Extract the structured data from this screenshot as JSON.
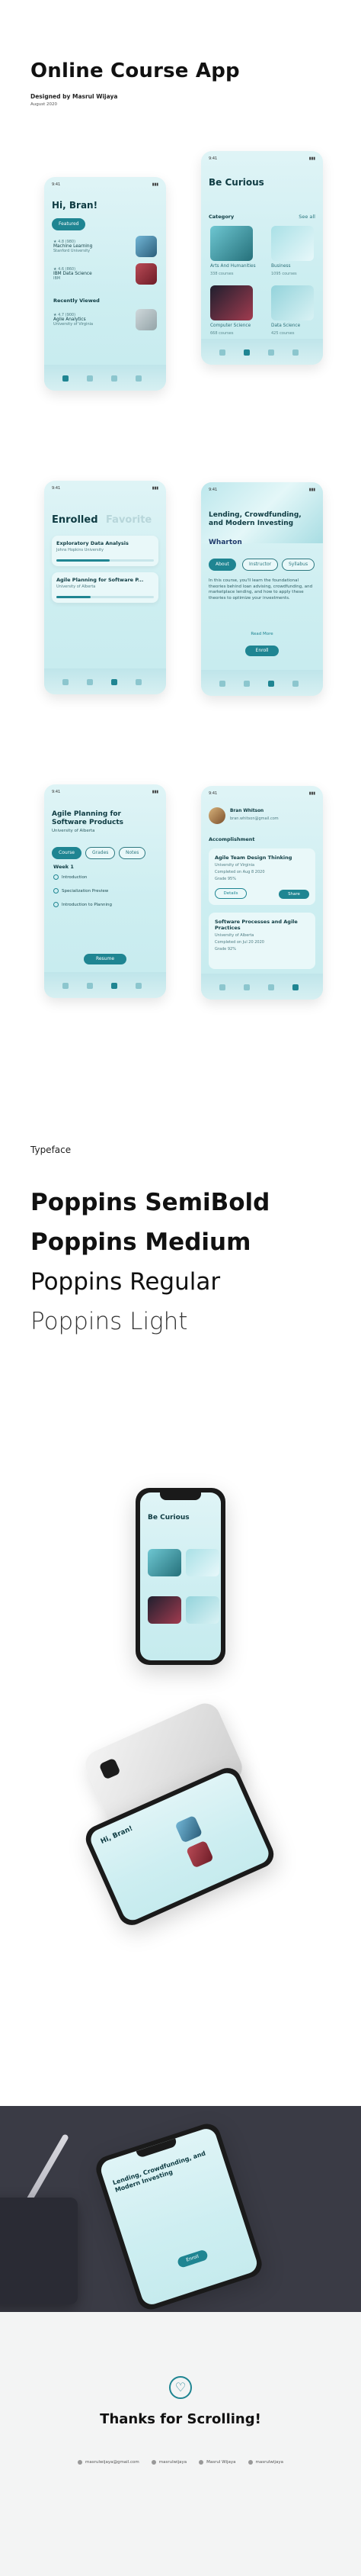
{
  "header": {
    "title": "Online Course App",
    "designed_by": "Designed by Masrul Wijaya",
    "date": "August 2020"
  },
  "screens": {
    "home": {
      "status_left": "9:41",
      "status_right": "▮▮▮",
      "greeting": "Hi, Bran!",
      "featured_chip": "Featured",
      "featured_items": [
        {
          "badge": "★ 4.8 (980)",
          "title": "Machine Learning",
          "sub": "Stanford University"
        },
        {
          "badge": "★ 4.6 (860)",
          "title": "IBM Data Science",
          "sub": "IBM"
        }
      ],
      "recent_label": "Recently Viewed",
      "recent_item": {
        "badge": "★ 4.7 (900)",
        "title": "Agile Analytics",
        "sub": "University of Virginia"
      }
    },
    "browse": {
      "status_left": "9:41",
      "status_right": "▮▮▮",
      "title": "Be Curious",
      "category_label": "Category",
      "category_right": "See all",
      "categories": [
        {
          "name": "Arts And Humanities",
          "count": "338 courses"
        },
        {
          "name": "Business",
          "count": "1095 courses"
        },
        {
          "name": "Computer Science",
          "count": "668 courses"
        },
        {
          "name": "Data Science",
          "count": "425 courses"
        }
      ]
    },
    "enrolled": {
      "status_left": "9:41",
      "status_right": "▮▮▮",
      "tab_active": "Enrolled",
      "tab_inactive": "Favorite",
      "courses": [
        {
          "title": "Exploratory Data Analysis",
          "sub": "Johns Hopkins University",
          "progress": 0.55
        },
        {
          "title": "Agile Planning for Software P...",
          "sub": "University of Alberta",
          "progress": 0.35
        }
      ]
    },
    "course_detail": {
      "status_left": "9:41",
      "status_right": "▮▮▮",
      "title": "Lending, Crowdfunding, and Modern Investing",
      "institution": "Wharton",
      "tabs": [
        "About",
        "Instructor",
        "Syllabus"
      ],
      "description": "In this course, you'll learn the foundational theories behind loan advising, crowdfunding, and marketplace lending, and how to apply these theories to optimize your investments.",
      "read_more": "Read More",
      "enroll": "Enroll"
    },
    "syllabus": {
      "status_left": "9:41",
      "status_right": "▮▮▮",
      "title": "Agile Planning for Software Products",
      "institution": "University of Alberta",
      "tabs": [
        "Course",
        "Grades",
        "Notes"
      ],
      "week_label": "Week 1",
      "week_items": [
        "Introduction",
        "Specialization Preview",
        "Introduction to Planning"
      ],
      "resume": "Resume"
    },
    "profile": {
      "status_left": "9:41",
      "status_right": "▮▮▮",
      "name": "Bran Whitson",
      "email": "bran.whitson@gmail.com",
      "accomplishment_label": "Accomplishment",
      "cards": [
        {
          "title": "Agile Team Design Thinking",
          "sub": "University of Virginia",
          "completed": "Completed on Aug 8 2020",
          "grade": "Grade 95%"
        },
        {
          "title": "Software Processes and Agile Practices",
          "sub": "University of Alberta",
          "completed": "Completed on Jul 20 2020",
          "grade": "Grade 92%"
        }
      ],
      "details": "Details",
      "share": "Share"
    }
  },
  "typeface": {
    "label": "Typeface",
    "lines": [
      "Poppins SemiBold",
      "Poppins Medium",
      "Poppins Regular",
      "Poppins Light"
    ]
  },
  "mockups": {
    "phone1_title": "Be Curious",
    "phone2_greeting": "Hi, Bran!",
    "phone3_title": "Lending, Crowdfunding, and Modern Investing"
  },
  "thanks": {
    "title": "Thanks for Scrolling!",
    "footer": [
      {
        "label": "masrulwijaya@gmail.com",
        "icon": "mail-icon"
      },
      {
        "label": "masrulwijaya",
        "icon": "user-icon"
      },
      {
        "label": "Masrul Wijaya",
        "icon": "profile-icon"
      },
      {
        "label": "masrulwijaya",
        "icon": "camera-icon"
      }
    ]
  },
  "colors": {
    "accent": "#1f8592",
    "screen_bg": "#cdeef1",
    "text_dark": "#0e3b42"
  }
}
